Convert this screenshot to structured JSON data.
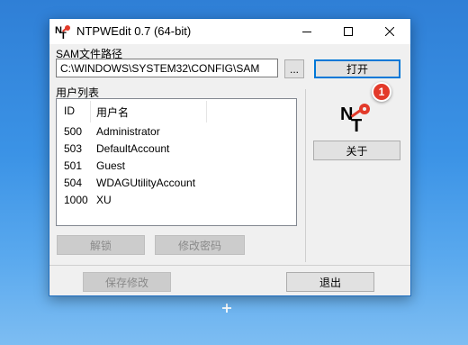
{
  "window": {
    "title": "NTPWEdit 0.7 (64-bit)",
    "minimize_icon": "minimize-icon",
    "maximize_icon": "maximize-icon",
    "close_icon": "close-icon"
  },
  "sam": {
    "label": "SAM文件路径",
    "path_value": "C:\\WINDOWS\\SYSTEM32\\CONFIG\\SAM",
    "browse_label": "...",
    "open_label": "打开"
  },
  "users": {
    "label": "用户列表",
    "columns": [
      "ID",
      "用户名"
    ],
    "rows": [
      {
        "id": "500",
        "name": "Administrator"
      },
      {
        "id": "503",
        "name": "DefaultAccount"
      },
      {
        "id": "501",
        "name": "Guest"
      },
      {
        "id": "504",
        "name": "WDAGUtilityAccount"
      },
      {
        "id": "1000",
        "name": "XU"
      }
    ]
  },
  "actions": {
    "unlock_label": "解锁",
    "change_password_label": "修改密码",
    "save_label": "保存修改",
    "exit_label": "退出",
    "about_label": "关于"
  },
  "annotation": {
    "badge_number": "1",
    "badge_color": "#e33a2a"
  },
  "colors": {
    "accent": "#0078d7",
    "desktop": "#3b93e6"
  }
}
